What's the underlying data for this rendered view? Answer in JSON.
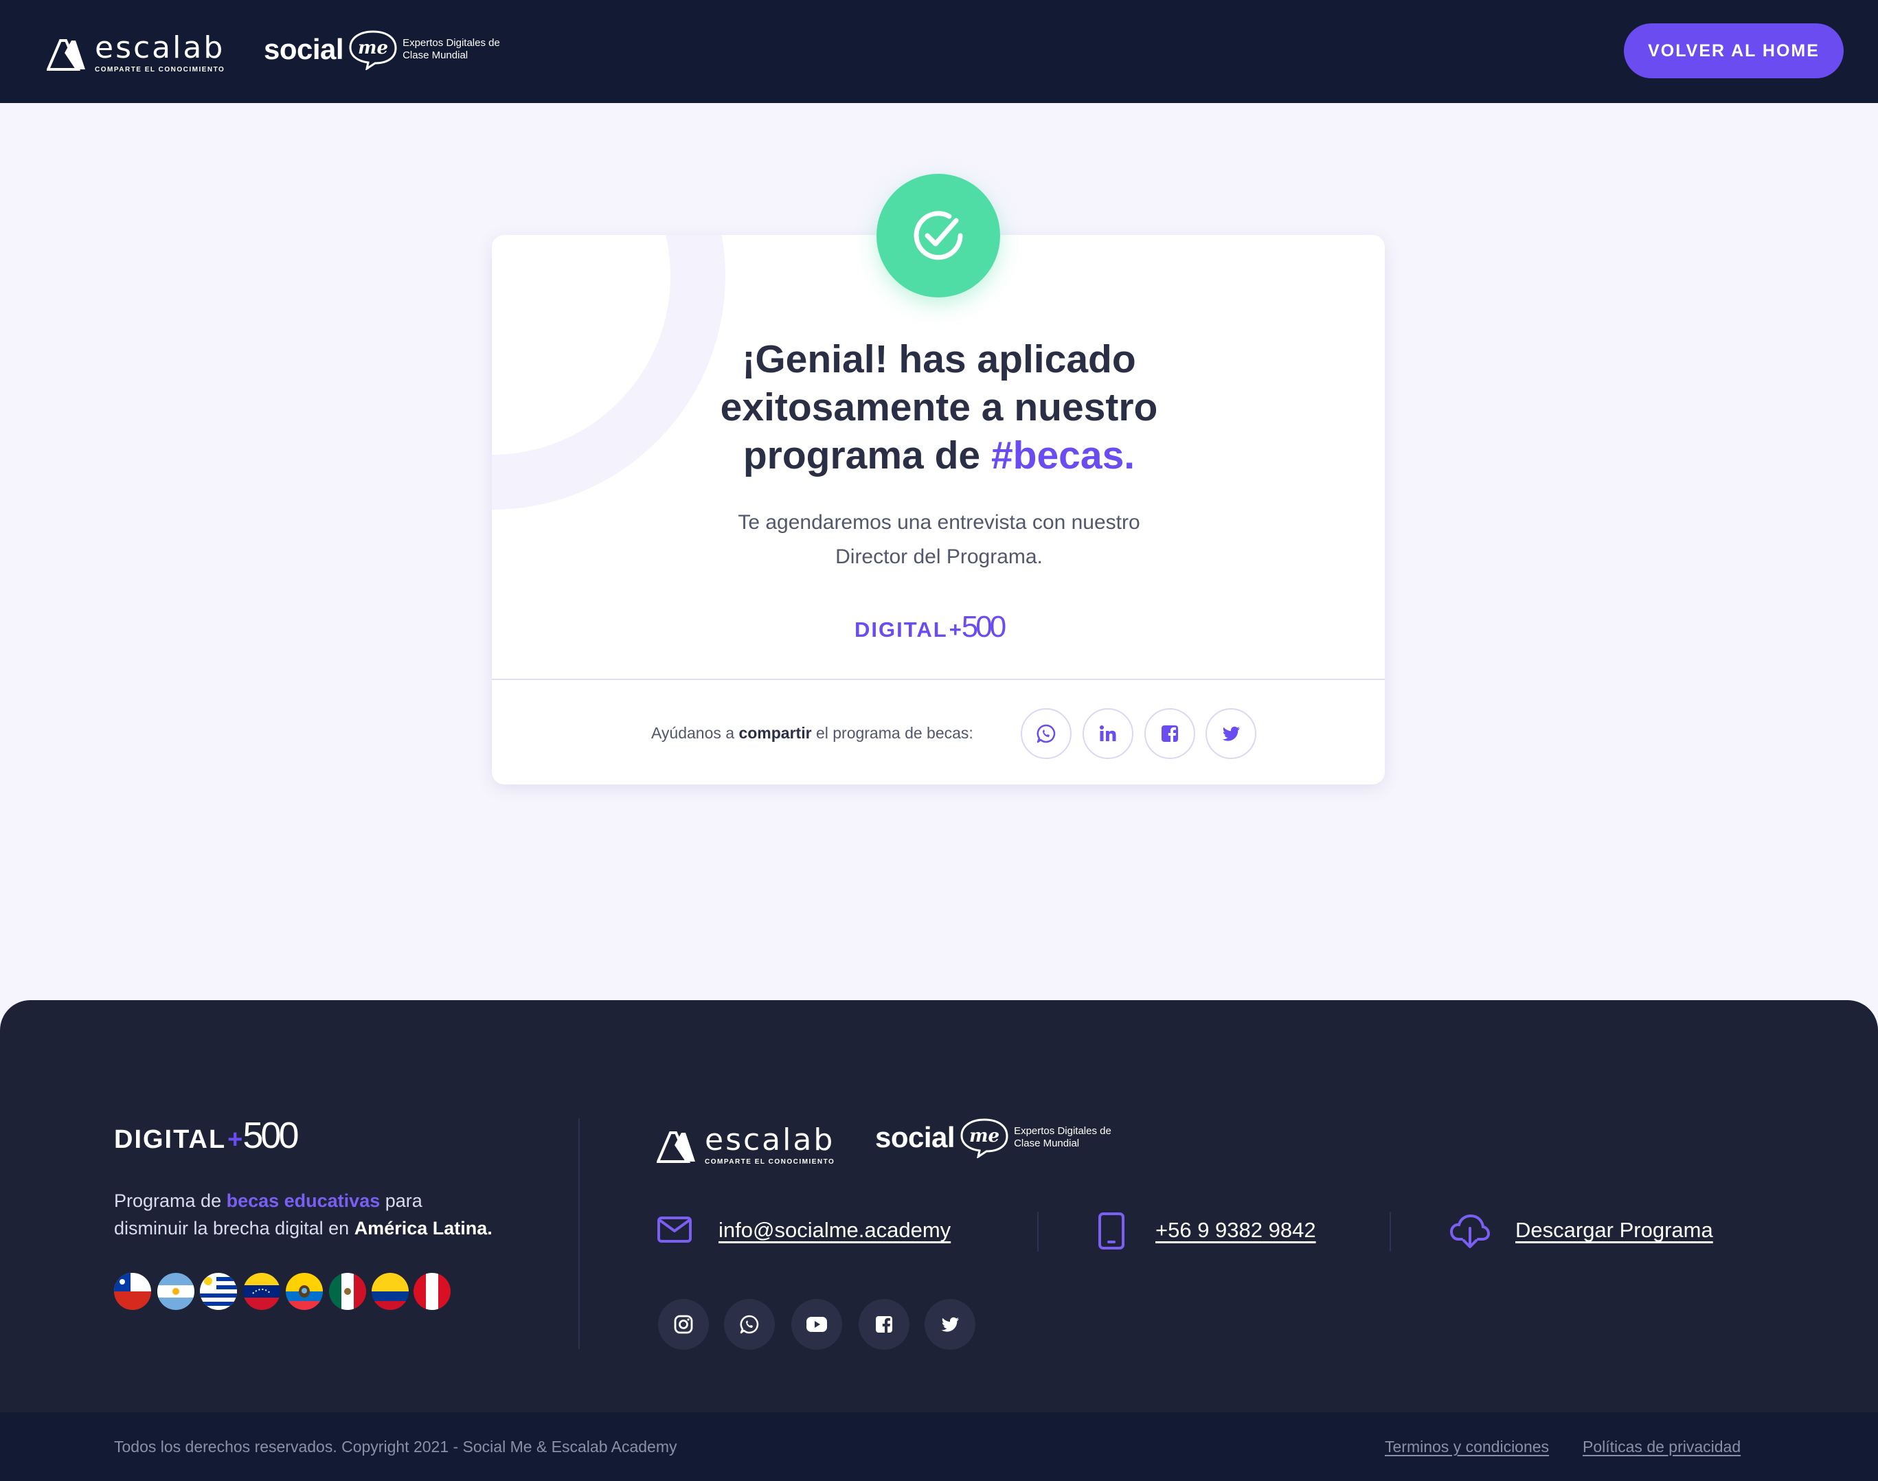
{
  "header": {
    "escalab": {
      "word": "escalab",
      "tagline": "COMPARTE EL CONOCIMIENTO"
    },
    "socialme": {
      "word": "social",
      "me": "me",
      "tagline_1": "Expertos Digitales de",
      "tagline_2": "Clase Mundial"
    },
    "home_button": "VOLVER AL HOME"
  },
  "card": {
    "title_line1": "¡Genial! has aplicado",
    "title_line2": "exitosamente a nuestro",
    "title_line3_pre": "programa de ",
    "title_line3_hl": "#becas.",
    "subtitle_line1": "Te agendaremos una entrevista con nuestro",
    "subtitle_line2": "Director del Programa.",
    "program_logo": {
      "word": "DIGITAL",
      "plus": "+",
      "number": "500"
    },
    "share": {
      "pre": "Ayúdanos a ",
      "bold": "compartir",
      "post": " el programa de becas:"
    },
    "share_icons": [
      "whatsapp-icon",
      "linkedin-icon",
      "facebook-icon",
      "twitter-icon"
    ]
  },
  "footer": {
    "program_logo": {
      "word": "DIGITAL",
      "plus": "+",
      "number": "500"
    },
    "desc": {
      "p1": "Programa de ",
      "hl": "becas educativas",
      "p2": " para",
      "p3": "disminuir la brecha digital en ",
      "bold": "América Latina."
    },
    "flags": [
      "chile",
      "argentina",
      "uruguay",
      "venezuela",
      "ecuador",
      "mexico",
      "colombia",
      "peru"
    ],
    "escalab": {
      "word": "escalab",
      "tagline": "COMPARTE EL CONOCIMIENTO"
    },
    "socialme": {
      "word": "social",
      "me": "me",
      "tagline_1": "Expertos Digitales de",
      "tagline_2": "Clase Mundial"
    },
    "email": "info@socialme.academy",
    "phone": "+56 9 9382 9842",
    "download": "Descargar Programa",
    "social_icons": [
      "instagram-icon",
      "whatsapp-icon",
      "youtube-icon",
      "facebook-icon",
      "twitter-icon"
    ],
    "copyright": "Todos los derechos reservados. Copyright 2021 - Social Me & Escalab Academy",
    "terms": "Terminos y condiciones",
    "privacy": "Políticas de privacidad"
  },
  "colors": {
    "accent": "#6a4cf0",
    "success": "#4fdda5",
    "header_bg": "#131a33",
    "footer_bg": "#1d2237",
    "page_bg": "#f6f5fd"
  }
}
